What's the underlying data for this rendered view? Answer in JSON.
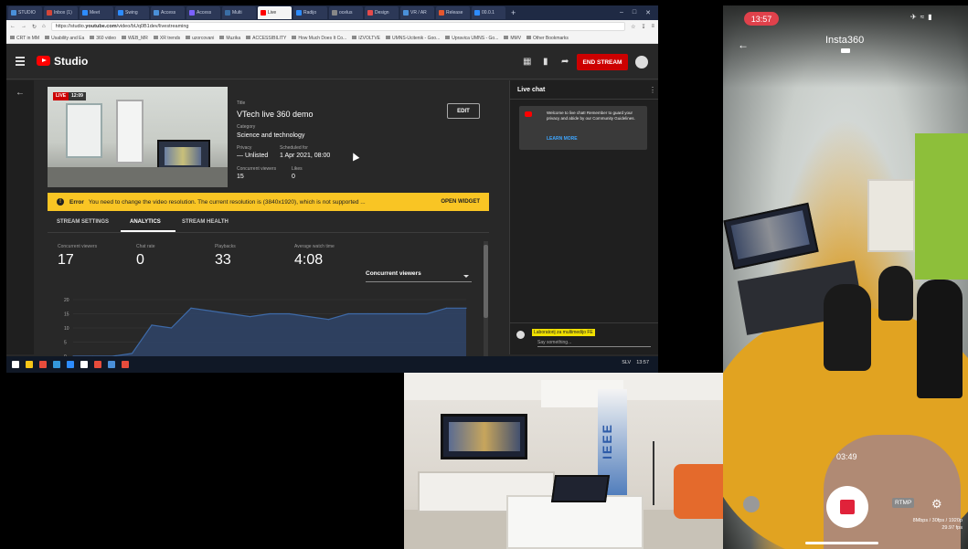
{
  "browser": {
    "tabs": [
      {
        "label": "STUDIO",
        "color": "#4a90d9"
      },
      {
        "label": "Inbox (1)",
        "color": "#d44638"
      },
      {
        "label": "Meet",
        "color": "#2d8cff"
      },
      {
        "label": "Swing",
        "color": "#2d8cff"
      },
      {
        "label": "Access",
        "color": "#4a90d9"
      },
      {
        "label": "Access",
        "color": "#7b61ff"
      },
      {
        "label": "Multi",
        "color": "#3a6ea5"
      },
      {
        "label": "Live",
        "color": "#ff0000"
      },
      {
        "label": "Radijo",
        "color": "#2d8cff"
      },
      {
        "label": "ocelus",
        "color": "#888888"
      },
      {
        "label": "Design",
        "color": "#e54b4b"
      },
      {
        "label": "VR / AR",
        "color": "#4a90d9"
      },
      {
        "label": "Release",
        "color": "#e4572e"
      },
      {
        "label": "00.0.1",
        "color": "#2d8cff"
      }
    ],
    "url_prefix": "https://studio.",
    "url_domain": "youtube.com",
    "url_path": "/video/bUq0B1dev/livestreaming",
    "bookmarks": [
      "CRT in MM",
      "Usability and Ea",
      "360 video",
      "WEB_MR",
      "XR trends",
      "uzorcovani",
      "Muzika",
      "ACCESSIBILITY",
      "How Much Does It Co...",
      "IZVOLTVE",
      "UMNS-Ucitenik - Goo...",
      "Upravica UMNS - Go...",
      "MMV",
      "Other Bookmarks"
    ]
  },
  "studio": {
    "logo_label": "Studio",
    "end_stream_label": "END STREAM",
    "live_label": "LIVE",
    "live_time": "12:09",
    "title_label": "Title",
    "title_value": "VTech live 360 demo",
    "category_label": "Category",
    "category_value": "Science and technology",
    "privacy_label": "Privacy",
    "privacy_value": "— Unlisted",
    "scheduled_label": "Scheduled for",
    "scheduled_value": "1 Apr 2021, 08:00",
    "cv_label": "Concurrent viewers",
    "cv_value": "15",
    "likes_label": "Likes",
    "likes_value": "0",
    "edit_label": "EDIT",
    "error_icon": "!",
    "error_title": "Error",
    "error_message": "You need to change the video resolution. The current resolution is (3840x1920), which is not supported ...",
    "open_widget_label": "OPEN WIDGET",
    "tabs": [
      "STREAM SETTINGS",
      "ANALYTICS",
      "STREAM HEALTH"
    ],
    "stats": [
      {
        "label": "Concurrent viewers",
        "value": "17"
      },
      {
        "label": "Chat rate",
        "value": "0"
      },
      {
        "label": "Playbacks",
        "value": "33"
      },
      {
        "label": "Average watch time",
        "value": "4:08"
      }
    ],
    "metric_select": "Concurrent viewers"
  },
  "chart_data": {
    "type": "area",
    "title": "",
    "xlabel": "",
    "ylabel": "",
    "ylim": [
      0,
      20
    ],
    "y_ticks": [
      "20",
      "15",
      "10",
      "5",
      "0"
    ],
    "x": [
      0,
      1,
      2,
      3,
      4,
      5,
      6,
      7,
      8,
      9,
      10,
      11,
      12,
      13,
      14,
      15,
      16,
      17,
      18,
      19,
      20
    ],
    "values": [
      0,
      0,
      0,
      1,
      11,
      10,
      17,
      16,
      15,
      14,
      15,
      15,
      14,
      13,
      15,
      15,
      15,
      15,
      15,
      17,
      17
    ],
    "color": "#3e6aa8",
    "fill": "#2f4468"
  },
  "chat": {
    "title": "Live chat",
    "welcome": "Welcome to live chat! Remember to guard your privacy and abide by our Community Guidelines.",
    "learn_more": "LEARN MORE",
    "user_name": "Laboratorij za multimedijo FE",
    "input_placeholder": "Say something..."
  },
  "taskbar": {
    "icon_colors": [
      "#ffffff",
      "#f5c518",
      "#e74c3c",
      "#3498db",
      "#2d8cff",
      "#ffffff",
      "#e74c3c",
      "#4a90d9",
      "#e74c3c"
    ],
    "lang": "SLV",
    "time": "13:57"
  },
  "phone": {
    "time": "13:57",
    "app_title": "Insta360",
    "rec_timer": "03:49",
    "rtmp_label": "RTMP",
    "stream_info_1": "8Mbps / 30fps / 1920p",
    "stream_info_2": "29.97 fps"
  },
  "room": {
    "banner_text": "IEEE"
  }
}
